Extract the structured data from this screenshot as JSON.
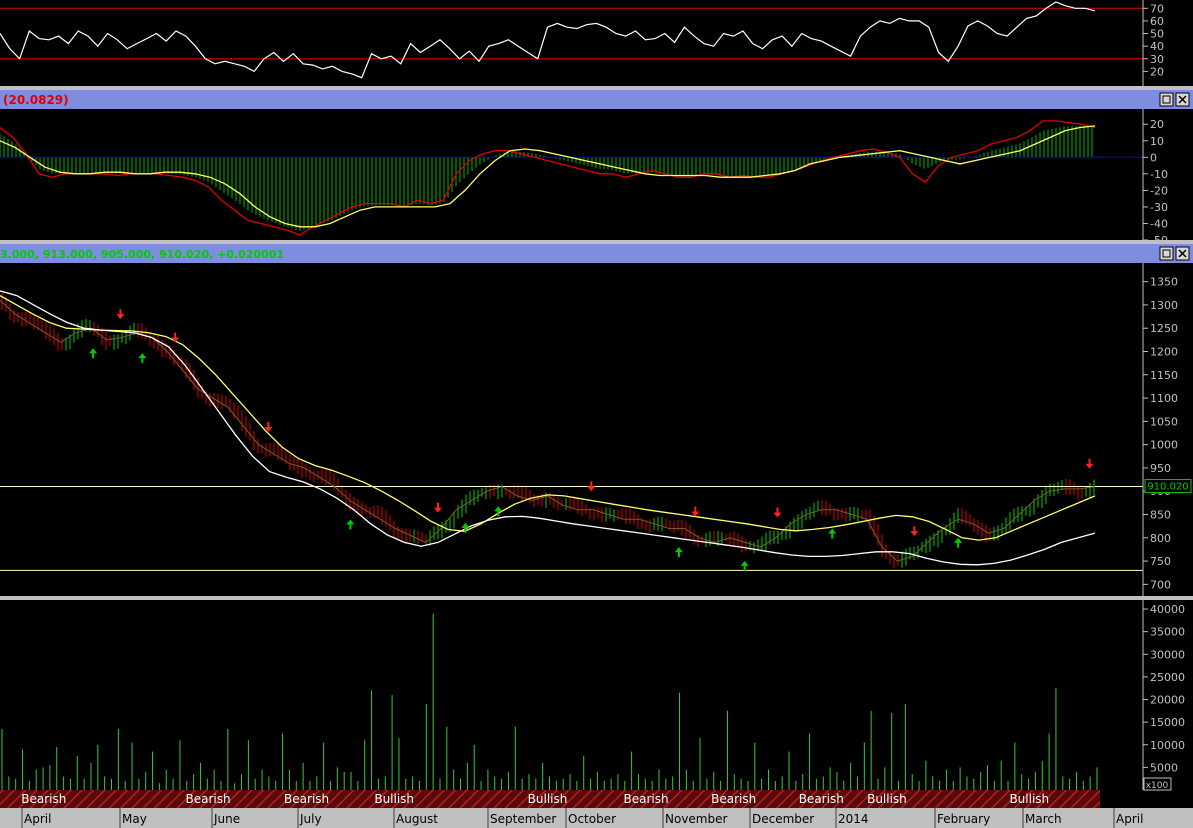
{
  "panes": {
    "rsi": {
      "ticks": [
        "70",
        "60",
        "50",
        "40",
        "30",
        "20"
      ],
      "lines": [
        70,
        30
      ]
    },
    "macd": {
      "label": "(20.0829)",
      "ticks": [
        "20",
        "10",
        "0",
        "-10",
        "-20",
        "-30",
        "-40",
        "-50"
      ]
    },
    "price": {
      "header": "3.000, 913.000, 905.000, 910.020, +0.020001",
      "ticks": [
        "1350",
        "1300",
        "1250",
        "1200",
        "1150",
        "1100",
        "1050",
        "1000",
        "950",
        "900",
        "850",
        "800",
        "750",
        "700"
      ],
      "last_price": "910.020"
    },
    "volume": {
      "ticks": [
        "40000",
        "35000",
        "30000",
        "25000",
        "20000",
        "15000",
        "10000",
        "5000"
      ],
      "unit": "x100"
    }
  },
  "sentiment_labels": [
    {
      "label": "Bearish",
      "pos": 0.04
    },
    {
      "label": "Bearish",
      "pos": 0.19
    },
    {
      "label": "Bearish",
      "pos": 0.28
    },
    {
      "label": "Bullish",
      "pos": 0.36
    },
    {
      "label": "Bullish",
      "pos": 0.5
    },
    {
      "label": "Bearish",
      "pos": 0.59
    },
    {
      "label": "Bearish",
      "pos": 0.67
    },
    {
      "label": "Bearish",
      "pos": 0.75
    },
    {
      "label": "Bullish",
      "pos": 0.81
    },
    {
      "label": "Bullish",
      "pos": 0.94
    }
  ],
  "months": [
    "April",
    "May",
    "June",
    "July",
    "August",
    "September",
    "October",
    "November",
    "December",
    "2014",
    "February",
    "March",
    "April"
  ],
  "colors": {
    "background": "#000000",
    "frame": "#c0c0c0",
    "titlebar": "#7f8de0",
    "up": "#00cc00",
    "down": "#e00000",
    "ma_fast": "#ffff66",
    "ma_slow": "#ffffff",
    "level_line": "#ffffcc"
  },
  "chart_data": [
    {
      "type": "line",
      "title": "",
      "ylim": [
        10,
        75
      ],
      "series": [
        {
          "values": [
            50,
            38,
            30,
            52,
            46,
            45,
            48,
            42,
            52,
            48,
            40,
            50,
            45,
            38,
            42,
            46,
            50,
            44,
            52,
            48,
            40,
            30,
            26,
            28,
            26,
            24,
            20,
            30,
            35,
            28,
            34,
            26,
            25,
            22,
            24,
            20,
            18,
            15,
            34,
            30,
            32,
            26,
            42,
            35,
            40,
            45,
            38,
            30,
            36,
            28,
            40,
            42,
            45,
            40,
            35,
            30,
            55,
            58,
            55,
            54,
            57,
            58,
            55,
            50,
            48,
            52,
            45,
            46,
            50,
            43,
            55,
            48,
            42,
            40,
            50,
            48,
            52,
            42,
            38,
            45,
            48,
            40,
            50,
            46,
            44,
            40,
            36,
            32,
            48,
            55,
            60,
            58,
            62,
            60,
            60,
            55,
            35,
            28,
            40,
            56,
            60,
            56,
            50,
            48,
            55,
            62,
            64,
            70,
            75,
            72,
            70,
            70,
            68
          ]
        }
      ]
    },
    {
      "type": "line",
      "title": "",
      "ylim": [
        -50,
        28
      ],
      "series": [
        {
          "values": [
            18,
            12,
            2,
            -10,
            -12,
            -10,
            -10,
            -10,
            -10,
            -11,
            -10,
            -10,
            -10,
            -11,
            -12,
            -14,
            -18,
            -26,
            -32,
            -38,
            -40,
            -42,
            -44,
            -47,
            -42,
            -38,
            -34,
            -30,
            -28,
            -28,
            -28,
            -30,
            -26,
            -28,
            -26,
            -10,
            -2,
            2,
            4,
            4,
            2,
            0,
            -2,
            -4,
            -6,
            -8,
            -10,
            -10,
            -12,
            -10,
            -8,
            -10,
            -12,
            -12,
            -10,
            -10,
            -12,
            -11,
            -12,
            -12,
            -10,
            -8,
            -5,
            -2,
            0,
            2,
            4,
            5,
            3,
            0,
            -10,
            -15,
            -5,
            0,
            2,
            4,
            8,
            10,
            12,
            16,
            22,
            22,
            21,
            20,
            18
          ]
        },
        {
          "values": [
            10,
            6,
            0,
            -6,
            -9,
            -10,
            -10,
            -9,
            -9,
            -10,
            -10,
            -9,
            -9,
            -10,
            -12,
            -16,
            -22,
            -30,
            -36,
            -40,
            -42,
            -42,
            -40,
            -36,
            -32,
            -30,
            -30,
            -30,
            -30,
            -30,
            -28,
            -20,
            -10,
            -2,
            4,
            5,
            4,
            2,
            0,
            -2,
            -4,
            -6,
            -8,
            -10,
            -11,
            -11,
            -11,
            -11,
            -12,
            -12,
            -12,
            -11,
            -10,
            -8,
            -4,
            -2,
            0,
            1,
            2,
            3,
            4,
            2,
            0,
            -2,
            -4,
            -2,
            0,
            2,
            4,
            8,
            12,
            16,
            18,
            19
          ]
        }
      ]
    },
    {
      "type": "line",
      "title": "",
      "ylim": [
        675,
        1390
      ],
      "series": [
        {
          "values": [
            1310,
            1280,
            1260,
            1240,
            1220,
            1240,
            1250,
            1225,
            1230,
            1240,
            1230,
            1200,
            1160,
            1120,
            1100,
            1080,
            1040,
            1000,
            980,
            960,
            950,
            930,
            910,
            880,
            860,
            840,
            820,
            805,
            790,
            820,
            860,
            880,
            900,
            910,
            890,
            880,
            890,
            870,
            860,
            860,
            850,
            840,
            840,
            830,
            820,
            820,
            800,
            790,
            800,
            790,
            780,
            800,
            830,
            850,
            860,
            860,
            850,
            840,
            780,
            750,
            760,
            790,
            820,
            840,
            830,
            810,
            820,
            850,
            880,
            900,
            905,
            905,
            910
          ]
        },
        {
          "values": [
            1320,
            1300,
            1280,
            1262,
            1250,
            1248,
            1246,
            1245,
            1244,
            1240,
            1232,
            1215,
            1185,
            1150,
            1110,
            1070,
            1030,
            995,
            970,
            955,
            945,
            932,
            918,
            900,
            880,
            858,
            835,
            818,
            814,
            830,
            852,
            872,
            885,
            892,
            890,
            884,
            878,
            872,
            866,
            860,
            855,
            850,
            845,
            840,
            835,
            830,
            824,
            818,
            815,
            818,
            822,
            828,
            835,
            842,
            848,
            845,
            835,
            818,
            800,
            795,
            800,
            815,
            830,
            845,
            860,
            875,
            890
          ]
        },
        {
          "values": [
            1330,
            1320,
            1300,
            1280,
            1262,
            1250,
            1246,
            1243,
            1240,
            1230,
            1210,
            1170,
            1120,
            1070,
            1020,
            975,
            942,
            930,
            920,
            905,
            885,
            860,
            830,
            806,
            790,
            782,
            790,
            808,
            826,
            838,
            845,
            846,
            842,
            836,
            830,
            825,
            820,
            815,
            810,
            805,
            800,
            795,
            790,
            785,
            780,
            774,
            768,
            763,
            760,
            760,
            762,
            766,
            770,
            770,
            766,
            756,
            748,
            743,
            742,
            745,
            752,
            763,
            775,
            790,
            800,
            810
          ]
        }
      ]
    },
    {
      "type": "bar",
      "title": "",
      "ylim": [
        0,
        42000
      ],
      "series": [
        {
          "values": [
            13500,
            3000,
            2500,
            9000,
            2000,
            4500,
            5000,
            5500,
            9500,
            3000,
            2500,
            7500,
            2500,
            6000,
            10000,
            3000,
            2500,
            13500,
            2000,
            10500,
            2500,
            4000,
            8500,
            1500,
            4500,
            2500,
            11000,
            2000,
            3500,
            6000,
            2500,
            4500,
            2000,
            13500,
            1500,
            3500,
            11000,
            2500,
            4500,
            3000,
            2000,
            12500,
            4500,
            2000,
            6000,
            2000,
            3000,
            10500,
            2000,
            5000,
            4000,
            4000,
            2000,
            11000,
            22000,
            2500,
            3000,
            21000,
            11500,
            2500,
            3000,
            2000,
            19000,
            39000,
            2500,
            14000,
            4500,
            2500,
            6000,
            10000,
            2000,
            4500,
            3000,
            2500,
            4000,
            14000,
            2500,
            3500,
            2500,
            6000,
            3000,
            2000,
            2500,
            3500,
            2000,
            7500,
            2500,
            4000,
            2000,
            2500,
            3500,
            2000,
            8500,
            3500,
            2500,
            2000,
            4500,
            2500,
            3000,
            21500,
            4500,
            2000,
            11500,
            2500,
            4000,
            2000,
            17500,
            3500,
            2500,
            2000,
            10500,
            2500,
            4500,
            2000,
            3000,
            8500,
            2000,
            3500,
            12500,
            2500,
            3000,
            5000,
            4000,
            2000,
            6000,
            3000,
            10500,
            17500,
            2500,
            5000,
            17000,
            2000,
            19000,
            3500,
            2000,
            6500,
            3000,
            2000,
            4500,
            2000,
            5000,
            3000,
            2500,
            4000,
            5500,
            2000,
            6500,
            2000,
            10500,
            3500,
            2500,
            4000,
            6500,
            12500,
            22500,
            3000,
            2500,
            4000,
            2000,
            3000,
            5000
          ]
        }
      ]
    }
  ]
}
